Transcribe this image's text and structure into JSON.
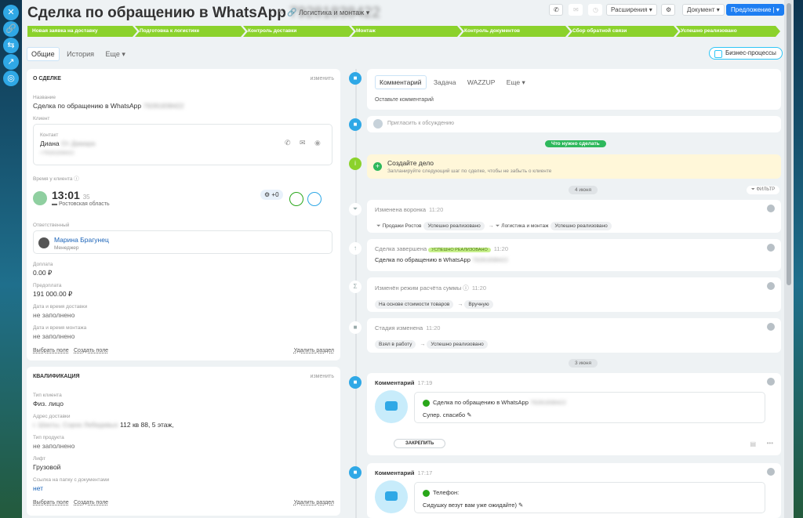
{
  "title": {
    "main": "Сделка по обращению в WhatsApp",
    "phone": "79281838422",
    "category": "Логистика и монтаж"
  },
  "toolbar": {
    "ext": "Расширения",
    "doc": "Документ",
    "offer": "Предложение"
  },
  "stages": [
    "Новая заявка на доставку",
    "Подготовка к логистике",
    "Контроль доставки",
    "Монтаж",
    "Контроль документов",
    "Сбор обратной связи",
    "Успешно реализовано"
  ],
  "tabs": {
    "general": "Общие",
    "history": "История",
    "more": "Еще"
  },
  "bp": "Бизнес-процессы",
  "about": {
    "header": "О СДЕЛКЕ",
    "edit": "изменить",
    "name_label": "Название",
    "name_value": "Сделка по обращению в WhatsApp",
    "name_phone": "79281838422",
    "client_label": "Клиент",
    "contact_label": "Контакт",
    "contact_name": "Диана",
    "contact_surname": "От Дамара",
    "contact_phone": "+79281838422",
    "time_label": "Время у клиента",
    "time_hm": "13:01",
    "time_s": "35",
    "region": "Ростовская область",
    "badge": "+0",
    "resp_label": "Ответственный",
    "resp_name": "Марина Брагунец",
    "resp_role": "Менеджер",
    "pay_label": "Доплата",
    "pay_value": "0.00 ₽",
    "pre_label": "Предоплата",
    "pre_value": "191 000.00 ₽",
    "del_label": "Дата и время доставки",
    "del_value": "не заполнено",
    "mnt_label": "Дата и время монтажа",
    "mnt_value": "не заполнено",
    "pick": "Выбрать поле",
    "create": "Создать поле",
    "delete": "Удалить раздел"
  },
  "qual": {
    "header": "КВАЛИФИКАЦИЯ",
    "edit": "изменить",
    "type_label": "Тип клиента",
    "type_value": "Физ. лицо",
    "addr_label": "Адрес доставки",
    "addr_blur": "г. Шахты, Сорок Лебедевых",
    "addr_value": "112 кв 88, 5 этаж,",
    "prod_label": "Тип продукта",
    "prod_value": "не заполнено",
    "lift_label": "Лифт",
    "lift_value": "Грузовой",
    "link_label": "Ссылка на папку с документами",
    "link_value": "нет",
    "pick": "Выбрать поле",
    "create": "Создать поле",
    "delete": "Удалить раздел"
  },
  "composer": {
    "tabs": [
      "Комментарий",
      "Задача",
      "WAZZUP",
      "Еще"
    ],
    "placeholder": "Оставьте комментарий",
    "invite": "Пригласить к обсуждению"
  },
  "todo": {
    "tag": "Что нужно сделать",
    "title": "Создайте дело",
    "text": "Запланируйте следующий шаг по сделке, чтобы не забыть о клиенте"
  },
  "sep1": "4 июня",
  "filter": "ФИЛЬТР",
  "sep2": "3 июня",
  "events": [
    {
      "title": "Изменена воронка",
      "time": "11:20",
      "from1": "Продажи Ростов",
      "from2": "Успешно реализовано",
      "to1": "Логистика и монтаж",
      "to2": "Успешно реализовано"
    },
    {
      "title": "Сделка завершена",
      "badge": "УСПЕШНО РЕАЛИЗОВАНО",
      "time": "11:20",
      "text": "Сделка по обращению в WhatsApp",
      "phone": "79281838422"
    },
    {
      "title": "Изменён режим расчёта суммы",
      "time": "11:20",
      "from": "На основе стоимости товаров",
      "to": "Вручную"
    },
    {
      "title": "Стадия изменена",
      "time": "11:20",
      "from": "Взял в работу",
      "to": "Успешно реализовано"
    }
  ],
  "comments": [
    {
      "title": "Комментарий",
      "time": "17:19",
      "line1": "Сделка по обращению в WhatsApp",
      "phone": "79281838422",
      "line2": "Супер. спасибо",
      "pin": "ЗАКРЕПИТЬ"
    },
    {
      "title": "Комментарий",
      "time": "17:17",
      "line1": "Телефон:",
      "line2": "Сидушку везут вам уже ожидайте)"
    }
  ]
}
